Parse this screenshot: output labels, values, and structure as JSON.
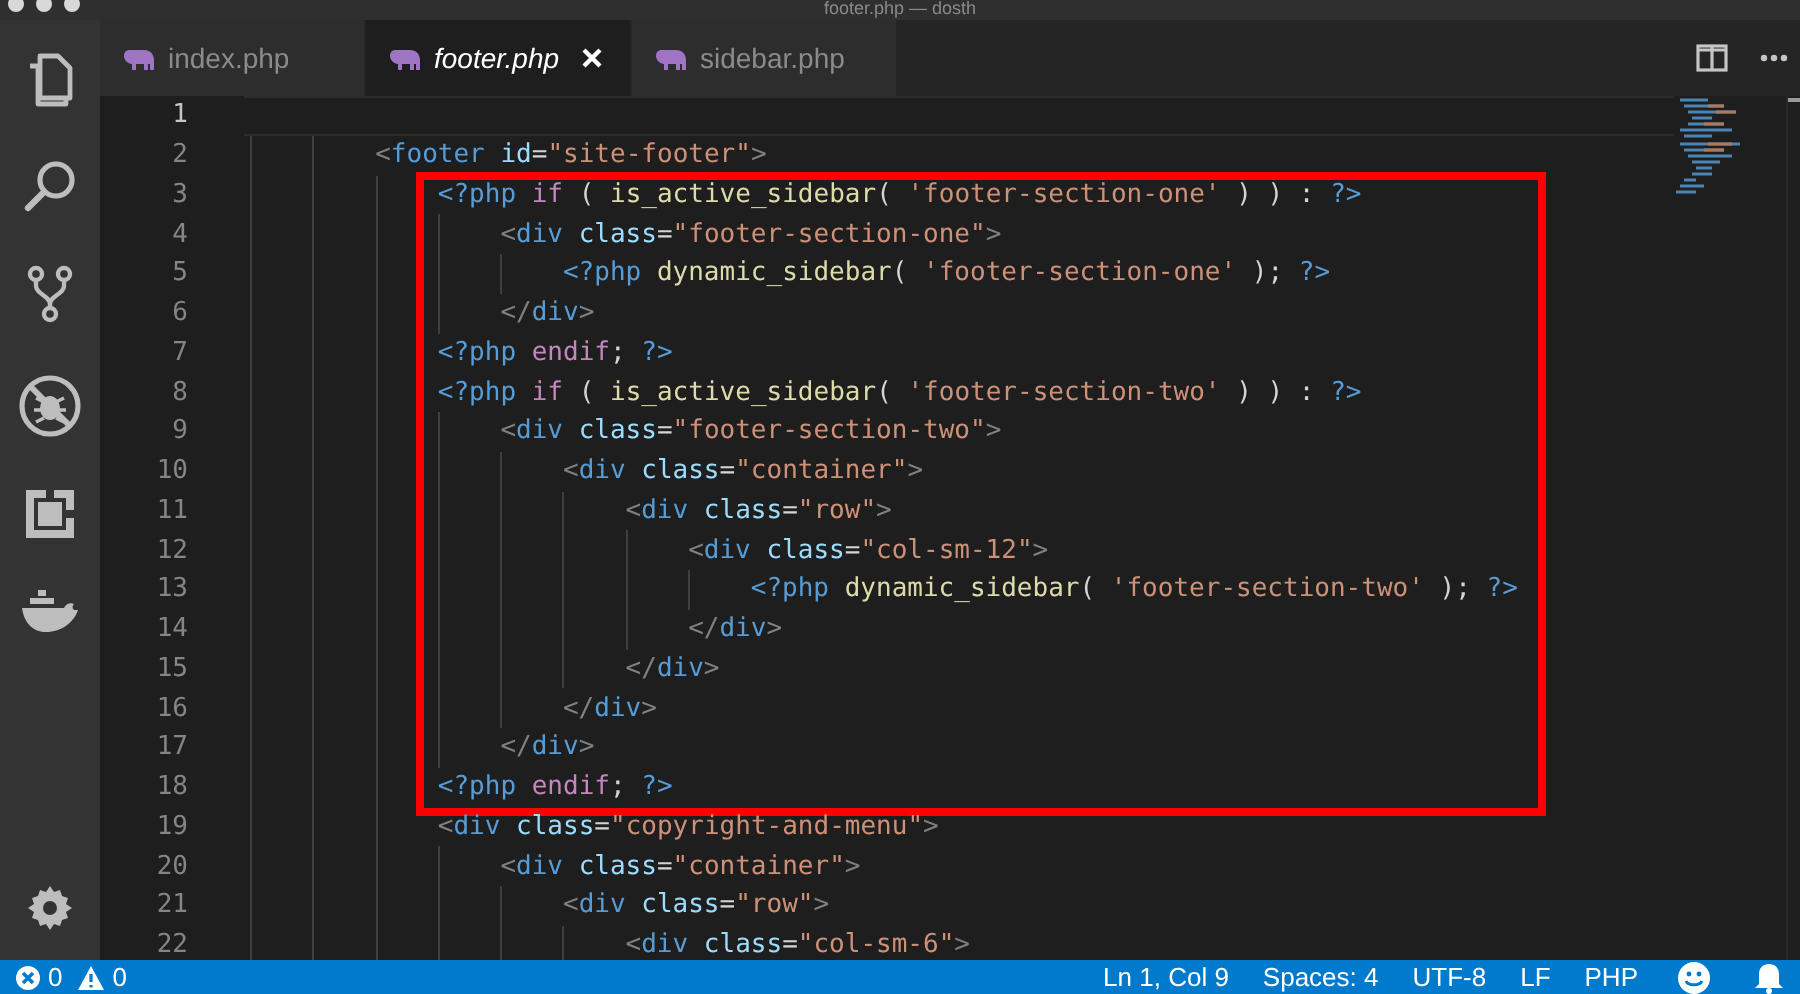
{
  "window": {
    "title": "footer.php — dosth"
  },
  "tabs": [
    {
      "label": "index.php",
      "selected": false,
      "preview": false
    },
    {
      "label": "footer.php",
      "selected": true,
      "preview": true
    },
    {
      "label": "sidebar.php",
      "selected": false,
      "preview": false
    }
  ],
  "editor": {
    "blocks": [
      {
        "kind": "plain",
        "lines": [
          {
            "number": "1",
            "current": true
          },
          {
            "number": "2",
            "current": false,
            "tokens": [
              {
                "kind": "punct",
                "text": "        <"
              },
              {
                "kind": "tag",
                "text": "footer"
              },
              {
                "kind": "attr",
                "text": " id"
              },
              {
                "kind": "text",
                "text": "="
              },
              {
                "kind": "str",
                "text": "\"site-footer\""
              },
              {
                "kind": "punct",
                "text": ">"
              }
            ]
          }
        ]
      },
      {
        "kind": "boxed",
        "lines": [
          {
            "number": "3",
            "current": false,
            "tokens": [
              {
                "kind": "php",
                "text": "            <?php"
              },
              {
                "kind": "kw",
                "text": " if"
              },
              {
                "kind": "text",
                "text": " ( "
              },
              {
                "kind": "fn",
                "text": "is_active_sidebar"
              },
              {
                "kind": "text",
                "text": "( "
              },
              {
                "kind": "str",
                "text": "'footer-section-one'"
              },
              {
                "kind": "text",
                "text": " ) ) : "
              },
              {
                "kind": "php",
                "text": "?>"
              }
            ]
          },
          {
            "number": "4",
            "current": false,
            "tokens": [
              {
                "kind": "punct",
                "text": "                <"
              },
              {
                "kind": "tag",
                "text": "div"
              },
              {
                "kind": "attr",
                "text": " class"
              },
              {
                "kind": "text",
                "text": "="
              },
              {
                "kind": "str",
                "text": "\"footer-section-one\""
              },
              {
                "kind": "punct",
                "text": ">"
              }
            ]
          },
          {
            "number": "5",
            "current": false,
            "tokens": [
              {
                "kind": "php",
                "text": "                    <?php"
              },
              {
                "kind": "fn",
                "text": " dynamic_sidebar"
              },
              {
                "kind": "text",
                "text": "( "
              },
              {
                "kind": "str",
                "text": "'footer-section-one'"
              },
              {
                "kind": "text",
                "text": " ); "
              },
              {
                "kind": "php",
                "text": "?>"
              }
            ]
          },
          {
            "number": "6",
            "current": false,
            "tokens": [
              {
                "kind": "punct",
                "text": "                </"
              },
              {
                "kind": "tag",
                "text": "div"
              },
              {
                "kind": "punct",
                "text": ">"
              }
            ]
          },
          {
            "number": "7",
            "current": false,
            "tokens": [
              {
                "kind": "php",
                "text": "            <?php"
              },
              {
                "kind": "kw",
                "text": " endif"
              },
              {
                "kind": "text",
                "text": "; "
              },
              {
                "kind": "php",
                "text": "?>"
              }
            ]
          },
          {
            "number": "8",
            "current": false,
            "tokens": [
              {
                "kind": "php",
                "text": "            <?php"
              },
              {
                "kind": "kw",
                "text": " if"
              },
              {
                "kind": "text",
                "text": " ( "
              },
              {
                "kind": "fn",
                "text": "is_active_sidebar"
              },
              {
                "kind": "text",
                "text": "( "
              },
              {
                "kind": "str",
                "text": "'footer-section-two'"
              },
              {
                "kind": "text",
                "text": " ) ) : "
              },
              {
                "kind": "php",
                "text": "?>"
              }
            ]
          },
          {
            "number": "9",
            "current": false,
            "tokens": [
              {
                "kind": "punct",
                "text": "                <"
              },
              {
                "kind": "tag",
                "text": "div"
              },
              {
                "kind": "attr",
                "text": " class"
              },
              {
                "kind": "text",
                "text": "="
              },
              {
                "kind": "str",
                "text": "\"footer-section-two\""
              },
              {
                "kind": "punct",
                "text": ">"
              }
            ]
          },
          {
            "number": "10",
            "current": false,
            "tokens": [
              {
                "kind": "punct",
                "text": "                    <"
              },
              {
                "kind": "tag",
                "text": "div"
              },
              {
                "kind": "attr",
                "text": " class"
              },
              {
                "kind": "text",
                "text": "="
              },
              {
                "kind": "str",
                "text": "\"container\""
              },
              {
                "kind": "punct",
                "text": ">"
              }
            ]
          },
          {
            "number": "11",
            "current": false,
            "tokens": [
              {
                "kind": "punct",
                "text": "                        <"
              },
              {
                "kind": "tag",
                "text": "div"
              },
              {
                "kind": "attr",
                "text": " class"
              },
              {
                "kind": "text",
                "text": "="
              },
              {
                "kind": "str",
                "text": "\"row\""
              },
              {
                "kind": "punct",
                "text": ">"
              }
            ]
          },
          {
            "number": "12",
            "current": false,
            "tokens": [
              {
                "kind": "punct",
                "text": "                            <"
              },
              {
                "kind": "tag",
                "text": "div"
              },
              {
                "kind": "attr",
                "text": " class"
              },
              {
                "kind": "text",
                "text": "="
              },
              {
                "kind": "str",
                "text": "\"col-sm-12\""
              },
              {
                "kind": "punct",
                "text": ">"
              }
            ]
          },
          {
            "number": "13",
            "current": false,
            "tokens": [
              {
                "kind": "php",
                "text": "                                <?php"
              },
              {
                "kind": "fn",
                "text": " dynamic_sidebar"
              },
              {
                "kind": "text",
                "text": "( "
              },
              {
                "kind": "str",
                "text": "'footer-section-two'"
              },
              {
                "kind": "text",
                "text": " ); "
              },
              {
                "kind": "php",
                "text": "?>"
              }
            ]
          },
          {
            "number": "14",
            "current": false,
            "tokens": [
              {
                "kind": "punct",
                "text": "                            </"
              },
              {
                "kind": "tag",
                "text": "div"
              },
              {
                "kind": "punct",
                "text": ">"
              }
            ]
          },
          {
            "number": "15",
            "current": false,
            "tokens": [
              {
                "kind": "punct",
                "text": "                        </"
              },
              {
                "kind": "tag",
                "text": "div"
              },
              {
                "kind": "punct",
                "text": ">"
              }
            ]
          },
          {
            "number": "16",
            "current": false,
            "tokens": [
              {
                "kind": "punct",
                "text": "                    </"
              },
              {
                "kind": "tag",
                "text": "div"
              },
              {
                "kind": "punct",
                "text": ">"
              }
            ]
          },
          {
            "number": "17",
            "current": false,
            "tokens": [
              {
                "kind": "punct",
                "text": "                </"
              },
              {
                "kind": "tag",
                "text": "div"
              },
              {
                "kind": "punct",
                "text": ">"
              }
            ]
          },
          {
            "number": "18",
            "current": false,
            "tokens": [
              {
                "kind": "php",
                "text": "            <?php"
              },
              {
                "kind": "kw",
                "text": " endif"
              },
              {
                "kind": "text",
                "text": "; "
              },
              {
                "kind": "php",
                "text": "?>"
              }
            ]
          }
        ]
      },
      {
        "kind": "plain",
        "lines": [
          {
            "number": "19",
            "current": false,
            "tokens": [
              {
                "kind": "punct",
                "text": "            <"
              },
              {
                "kind": "tag",
                "text": "div"
              },
              {
                "kind": "attr",
                "text": " class"
              },
              {
                "kind": "text",
                "text": "="
              },
              {
                "kind": "str",
                "text": "\"copyright-and-menu\""
              },
              {
                "kind": "punct",
                "text": ">"
              }
            ]
          },
          {
            "number": "20",
            "current": false,
            "tokens": [
              {
                "kind": "punct",
                "text": "                <"
              },
              {
                "kind": "tag",
                "text": "div"
              },
              {
                "kind": "attr",
                "text": " class"
              },
              {
                "kind": "text",
                "text": "="
              },
              {
                "kind": "str",
                "text": "\"container\""
              },
              {
                "kind": "punct",
                "text": ">"
              }
            ]
          },
          {
            "number": "21",
            "current": false,
            "tokens": [
              {
                "kind": "punct",
                "text": "                    <"
              },
              {
                "kind": "tag",
                "text": "div"
              },
              {
                "kind": "attr",
                "text": " class"
              },
              {
                "kind": "text",
                "text": "="
              },
              {
                "kind": "str",
                "text": "\"row\""
              },
              {
                "kind": "punct",
                "text": ">"
              }
            ]
          },
          {
            "number": "22",
            "current": false,
            "tokens": [
              {
                "kind": "punct",
                "text": "                        <"
              },
              {
                "kind": "tag",
                "text": "div"
              },
              {
                "kind": "attr",
                "text": " class"
              },
              {
                "kind": "text",
                "text": "="
              },
              {
                "kind": "str",
                "text": "\"col-sm-6\""
              },
              {
                "kind": "punct",
                "text": ">"
              }
            ]
          }
        ]
      }
    ]
  },
  "status_bar": {
    "errors": "0",
    "warnings": "0",
    "items": [
      "Ln 1, Col 9",
      "Spaces: 4",
      "UTF-8",
      "LF",
      "PHP"
    ]
  }
}
